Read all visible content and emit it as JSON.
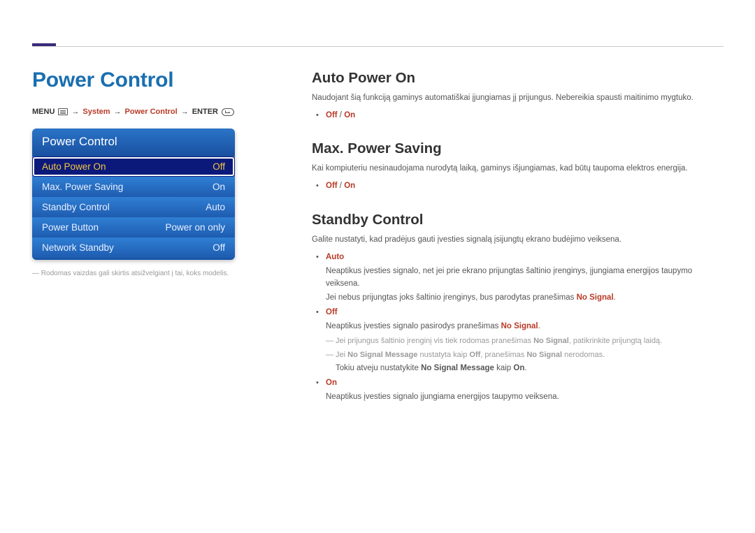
{
  "page_title": "Power Control",
  "breadcrumb": {
    "menu": "MENU",
    "arrow": "→",
    "system": "System",
    "power_control": "Power Control",
    "enter": "ENTER"
  },
  "osd": {
    "title": "Power Control",
    "items": [
      {
        "label": "Auto Power On",
        "value": "Off",
        "selected": true
      },
      {
        "label": "Max. Power Saving",
        "value": "On",
        "selected": false
      },
      {
        "label": "Standby Control",
        "value": "Auto",
        "selected": false
      },
      {
        "label": "Power Button",
        "value": "Power on only",
        "selected": false
      },
      {
        "label": "Network Standby",
        "value": "Off",
        "selected": false
      }
    ]
  },
  "footnote": "Rodomas vaizdas gali skirtis atsižvelgiant į tai, koks modelis.",
  "sections": {
    "auto_power_on": {
      "heading": "Auto Power On",
      "desc": "Naudojant šią funkciją gaminys automatiškai įjungiamas jį prijungus. Nebereikia spausti maitinimo mygtuko.",
      "opt_off": "Off",
      "opt_sep": " / ",
      "opt_on": "On"
    },
    "max_power_saving": {
      "heading": "Max. Power Saving",
      "desc": "Kai kompiuteriu nesinaudojama nurodytą laiką, gaminys išjungiamas, kad būtų taupoma elektros energija.",
      "opt_off": "Off",
      "opt_sep": " / ",
      "opt_on": "On"
    },
    "standby_control": {
      "heading": "Standby Control",
      "desc": "Galite nustatyti, kad pradėjus gauti įvesties signalą įsijungtų ekrano budėjimo veiksena.",
      "auto_label": "Auto",
      "auto_l1a": "Neaptikus įvesties signalo, net jei prie ekrano prijungtas šaltinio įrenginys, įjungiama energijos taupymo veiksena.",
      "auto_l2a": "Jei nebus prijungtas joks šaltinio įrenginys, bus parodytas pranešimas ",
      "auto_l2b": "No Signal",
      "auto_l2c": ".",
      "off_label": "Off",
      "off_l1a": "Neaptikus įvesties signalo pasirodys pranešimas ",
      "off_l1b": "No Signal",
      "off_l1c": ".",
      "off_n1a": "Jei prijungus šaltinio įrenginį vis tiek rodomas pranešimas ",
      "off_n1b": "No Signal",
      "off_n1c": ", patikrinkite prijungtą laidą.",
      "off_n2a": "Jei ",
      "off_n2b": "No Signal Message",
      "off_n2c": " nustatyta kaip ",
      "off_n2d": "Off",
      "off_n2e": ", pranešimas ",
      "off_n2f": "No Signal",
      "off_n2g": " nerodomas.",
      "off_n3a": "Tokiu atveju nustatykite ",
      "off_n3b": "No Signal Message",
      "off_n3c": " kaip ",
      "off_n3d": "On",
      "off_n3e": ".",
      "on_label": "On",
      "on_l1": "Neaptikus įvesties signalo įjungiama energijos taupymo veiksena."
    }
  }
}
